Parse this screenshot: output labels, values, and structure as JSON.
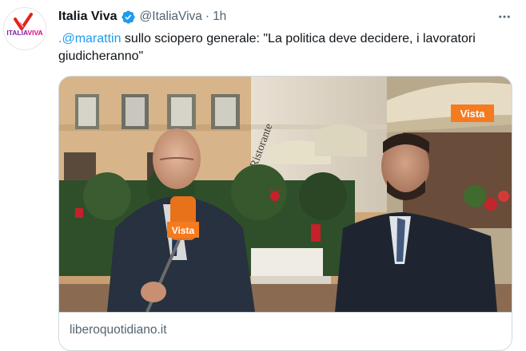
{
  "tweet": {
    "author_name": "Italia Viva",
    "handle": "@ItaliaViva",
    "separator": "·",
    "time": "1h",
    "mention": ".@marattin",
    "text": "  sullo sciopero generale: \"La politica deve decidere, i lavoratori giudicheranno\"",
    "avatar_logo_text": "ITALIAVIVA"
  },
  "card": {
    "domain": "liberoquotidiano.it",
    "watermark": "Vista",
    "mic_label": "Vista"
  },
  "colors": {
    "accent": "#1d9bf0",
    "text": "#0f1419",
    "muted": "#536471",
    "border": "#cfd9de",
    "vista_orange": "#f47b20"
  },
  "icons": {
    "verified": "verified-badge-icon",
    "more": "more-horizontal-icon"
  }
}
